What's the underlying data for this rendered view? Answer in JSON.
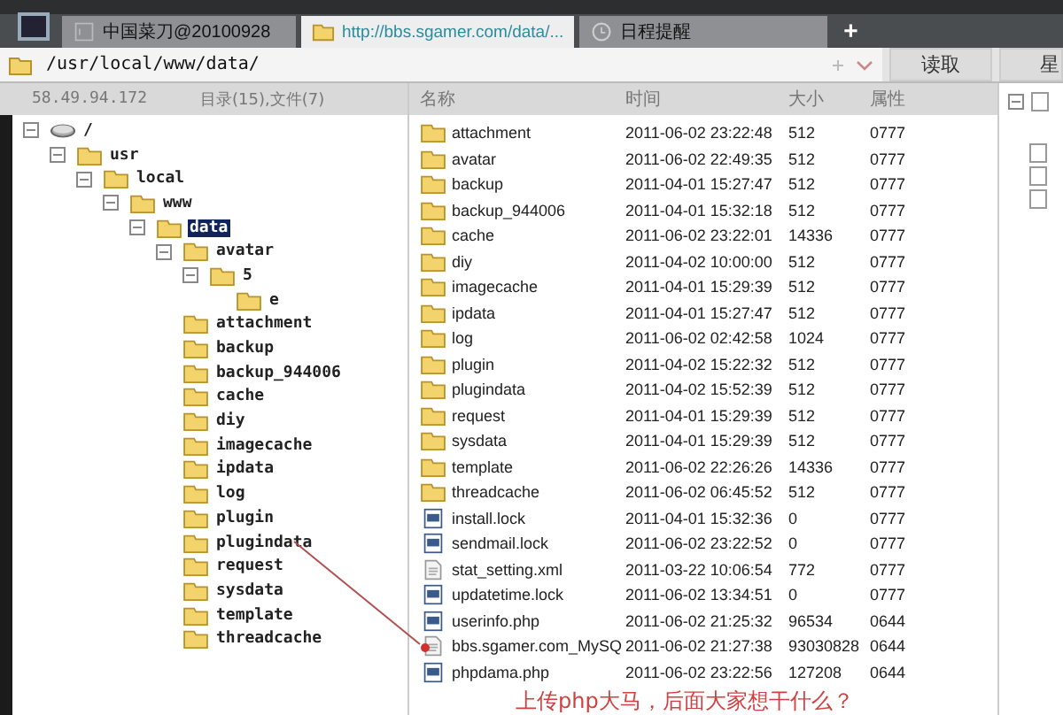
{
  "tabs": [
    {
      "label": "中国菜刀@20100928",
      "selected": false
    },
    {
      "label": "http://bbs.sgamer.com/data/...",
      "selected": true
    },
    {
      "label": "日程提醒",
      "selected": false
    }
  ],
  "new_tab": "+",
  "address": {
    "value": "/usr/local/www/data/",
    "button": "读取",
    "next_button": "星"
  },
  "left_header": {
    "host": "58.49.94.172",
    "counts": "目录(15),文件(7)"
  },
  "tree": [
    {
      "name": "/",
      "kind": "drive",
      "selected": false,
      "children": [
        {
          "name": "usr",
          "kind": "folder",
          "selected": false,
          "children": [
            {
              "name": "local",
              "kind": "folder",
              "selected": false,
              "children": [
                {
                  "name": "www",
                  "kind": "folder",
                  "selected": false,
                  "children": [
                    {
                      "name": "data",
                      "kind": "folder",
                      "selected": true,
                      "children": [
                        {
                          "name": "avatar",
                          "kind": "folder",
                          "selected": false,
                          "children": [
                            {
                              "name": "5",
                              "kind": "folder",
                              "selected": false,
                              "children": [
                                {
                                  "name": "e",
                                  "kind": "folder",
                                  "selected": false
                                }
                              ]
                            }
                          ]
                        },
                        {
                          "name": "attachment",
                          "kind": "folder",
                          "selected": false
                        },
                        {
                          "name": "backup",
                          "kind": "folder",
                          "selected": false
                        },
                        {
                          "name": "backup_944006",
                          "kind": "folder",
                          "selected": false
                        },
                        {
                          "name": "cache",
                          "kind": "folder",
                          "selected": false
                        },
                        {
                          "name": "diy",
                          "kind": "folder",
                          "selected": false
                        },
                        {
                          "name": "imagecache",
                          "kind": "folder",
                          "selected": false
                        },
                        {
                          "name": "ipdata",
                          "kind": "folder",
                          "selected": false
                        },
                        {
                          "name": "log",
                          "kind": "folder",
                          "selected": false
                        },
                        {
                          "name": "plugin",
                          "kind": "folder",
                          "selected": false
                        },
                        {
                          "name": "plugindata",
                          "kind": "folder",
                          "selected": false
                        },
                        {
                          "name": "request",
                          "kind": "folder",
                          "selected": false
                        },
                        {
                          "name": "sysdata",
                          "kind": "folder",
                          "selected": false
                        },
                        {
                          "name": "template",
                          "kind": "folder",
                          "selected": false
                        },
                        {
                          "name": "threadcache",
                          "kind": "folder",
                          "selected": false
                        }
                      ]
                    }
                  ]
                }
              ]
            }
          ]
        }
      ]
    }
  ],
  "columns": [
    "名称",
    "时间",
    "大小",
    "属性"
  ],
  "files": [
    {
      "kind": "folder",
      "name": "attachment",
      "time": "2011-06-02 23:22:48",
      "size": "512",
      "attr": "0777"
    },
    {
      "kind": "folder",
      "name": "avatar",
      "time": "2011-06-02 22:49:35",
      "size": "512",
      "attr": "0777"
    },
    {
      "kind": "folder",
      "name": "backup",
      "time": "2011-04-01 15:27:47",
      "size": "512",
      "attr": "0777"
    },
    {
      "kind": "folder",
      "name": "backup_944006",
      "time": "2011-04-01 15:32:18",
      "size": "512",
      "attr": "0777"
    },
    {
      "kind": "folder",
      "name": "cache",
      "time": "2011-06-02 23:22:01",
      "size": "14336",
      "attr": "0777"
    },
    {
      "kind": "folder",
      "name": "diy",
      "time": "2011-04-02 10:00:00",
      "size": "512",
      "attr": "0777"
    },
    {
      "kind": "folder",
      "name": "imagecache",
      "time": "2011-04-01 15:29:39",
      "size": "512",
      "attr": "0777"
    },
    {
      "kind": "folder",
      "name": "ipdata",
      "time": "2011-04-01 15:27:47",
      "size": "512",
      "attr": "0777"
    },
    {
      "kind": "folder",
      "name": "log",
      "time": "2011-06-02 02:42:58",
      "size": "1024",
      "attr": "0777"
    },
    {
      "kind": "folder",
      "name": "plugin",
      "time": "2011-04-02 15:22:32",
      "size": "512",
      "attr": "0777"
    },
    {
      "kind": "folder",
      "name": "plugindata",
      "time": "2011-04-02 15:52:39",
      "size": "512",
      "attr": "0777"
    },
    {
      "kind": "folder",
      "name": "request",
      "time": "2011-04-01 15:29:39",
      "size": "512",
      "attr": "0777"
    },
    {
      "kind": "folder",
      "name": "sysdata",
      "time": "2011-04-01 15:29:39",
      "size": "512",
      "attr": "0777"
    },
    {
      "kind": "folder",
      "name": "template",
      "time": "2011-06-02 22:26:26",
      "size": "14336",
      "attr": "0777"
    },
    {
      "kind": "folder",
      "name": "threadcache",
      "time": "2011-06-02 06:45:52",
      "size": "512",
      "attr": "0777"
    },
    {
      "kind": "file",
      "name": "install.lock",
      "time": "2011-04-01 15:32:36",
      "size": "0",
      "attr": "0777"
    },
    {
      "kind": "file",
      "name": "sendmail.lock",
      "time": "2011-06-02 23:22:52",
      "size": "0",
      "attr": "0777"
    },
    {
      "kind": "text",
      "name": "stat_setting.xml",
      "time": "2011-03-22 10:06:54",
      "size": "772",
      "attr": "0777"
    },
    {
      "kind": "file",
      "name": "updatetime.lock",
      "time": "2011-06-02 13:34:51",
      "size": "0",
      "attr": "0777"
    },
    {
      "kind": "file",
      "name": "userinfo.php",
      "time": "2011-06-02 21:25:32",
      "size": "96534",
      "attr": "0644"
    },
    {
      "kind": "text",
      "name": "bbs.sgamer.com_MySQ",
      "time": "2011-06-02 21:27:38",
      "size": "93030828",
      "attr": "0644"
    },
    {
      "kind": "file",
      "name": "phpdama.php",
      "time": "2011-06-02 23:22:56",
      "size": "127208",
      "attr": "0644"
    }
  ],
  "annotation": "上传php大马，后面大家想干什么？"
}
